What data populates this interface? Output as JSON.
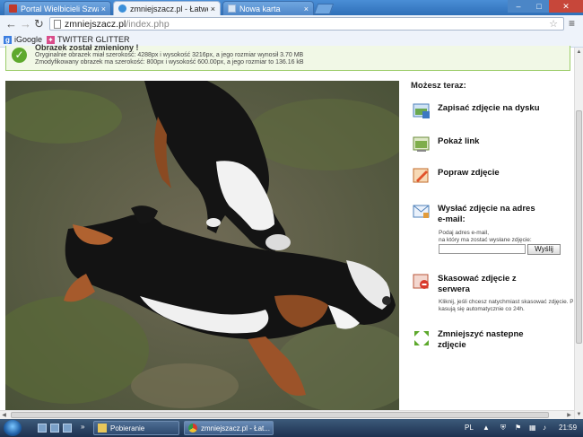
{
  "browser": {
    "tabs": [
      {
        "title": "Portal Wielbicieli Szwajca",
        "active": false
      },
      {
        "title": "zmniejszacz.pl - Łatwe zm",
        "active": true
      },
      {
        "title": "Nowa karta",
        "active": false
      }
    ],
    "tab_close_glyph": "×",
    "url_host": "zmniejszacz.pl",
    "url_path": "/index.php",
    "bookmarks": [
      {
        "label": "iGoogle",
        "icon": "google-icon"
      },
      {
        "label": "TWITTER GLITTER",
        "icon": "glitter-icon"
      }
    ],
    "nav_glyphs": {
      "back": "←",
      "forward": "→",
      "reload": "↻",
      "star": "☆",
      "menu": "≡"
    }
  },
  "notice": {
    "title": "Obrazek został zmieniony !",
    "line1": "Oryginalnie obrazek miał szerokość: 4288px i wysokość 3216px, a jego rozmiar wynosił 3.70 MB",
    "line2": "Zmodyfikowany obrazek ma szerokość: 800px i wysokość 600.00px, a jego rozmiar to 136.16 kB"
  },
  "panel": {
    "title": "Możesz teraz:",
    "save": "Zapisać zdjęcie na dysku",
    "link": "Pokaż link",
    "fix": "Popraw zdjęcie",
    "email_line1": "Wysłać zdjęcie na adres",
    "email_line2": "e-mail:",
    "email_hint1": "Podaj adres e-mail,",
    "email_hint2": "na który ma zostać wysłane zdjęcie:",
    "email_value": "",
    "send": "Wyślij",
    "delete_line1": "Skasować zdjęcie z",
    "delete_line2": "serwera",
    "delete_hint1": "Kliknij, jeśli chcesz natychmiast skasować zdjęcie. Plik",
    "delete_hint2": "kasują się automatycznie co 24h.",
    "next_line1": "Zmniejszyć nastepne",
    "next_line2": "zdjęcie"
  },
  "taskbar": {
    "tasks": [
      {
        "label": "Pobieranie"
      },
      {
        "label": "zmniejszacz.pl - Łat..."
      }
    ],
    "lang": "PL",
    "time": "21:59"
  },
  "colors": {
    "notice_bg": "#f1f8e6",
    "notice_border": "#9ccd6a",
    "check_green": "#5ea92d",
    "titlebar_blue": "#2f6fb8"
  }
}
